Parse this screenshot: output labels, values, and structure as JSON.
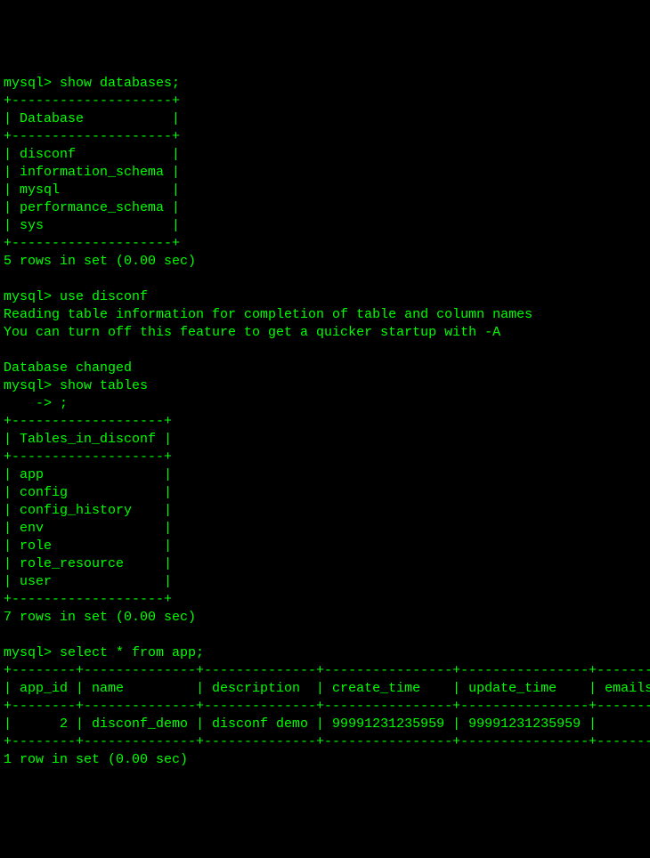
{
  "prompt": "mysql>",
  "continuation": "    ->",
  "commands": {
    "show_databases": "show databases;",
    "use_disconf": "use disconf",
    "show_tables": "show tables",
    "semicolon": ";",
    "select_app": "select * from app;"
  },
  "databases": {
    "header": "Database",
    "border": "+--------------------+",
    "rows": [
      "disconf",
      "information_schema",
      "mysql",
      "performance_schema",
      "sys"
    ],
    "footer": "5 rows in set (0.00 sec)"
  },
  "use_output": {
    "line1": "Reading table information for completion of table and column names",
    "line2": "You can turn off this feature to get a quicker startup with -A",
    "line3": "Database changed"
  },
  "tables": {
    "header": "Tables_in_disconf",
    "border": "+-------------------+",
    "rows": [
      "app",
      "config",
      "config_history",
      "env",
      "role",
      "role_resource",
      "user"
    ],
    "footer": "7 rows in set (0.00 sec)"
  },
  "app_table": {
    "border": "+--------+--------------+--------------+----------------+----------------+--------+",
    "header": "| app_id | name         | description  | create_time    | update_time    | emails |",
    "row": "|      2 | disconf_demo | disconf demo | 99991231235959 | 99991231235959 |        |",
    "footer": "1 row in set (0.00 sec)"
  }
}
